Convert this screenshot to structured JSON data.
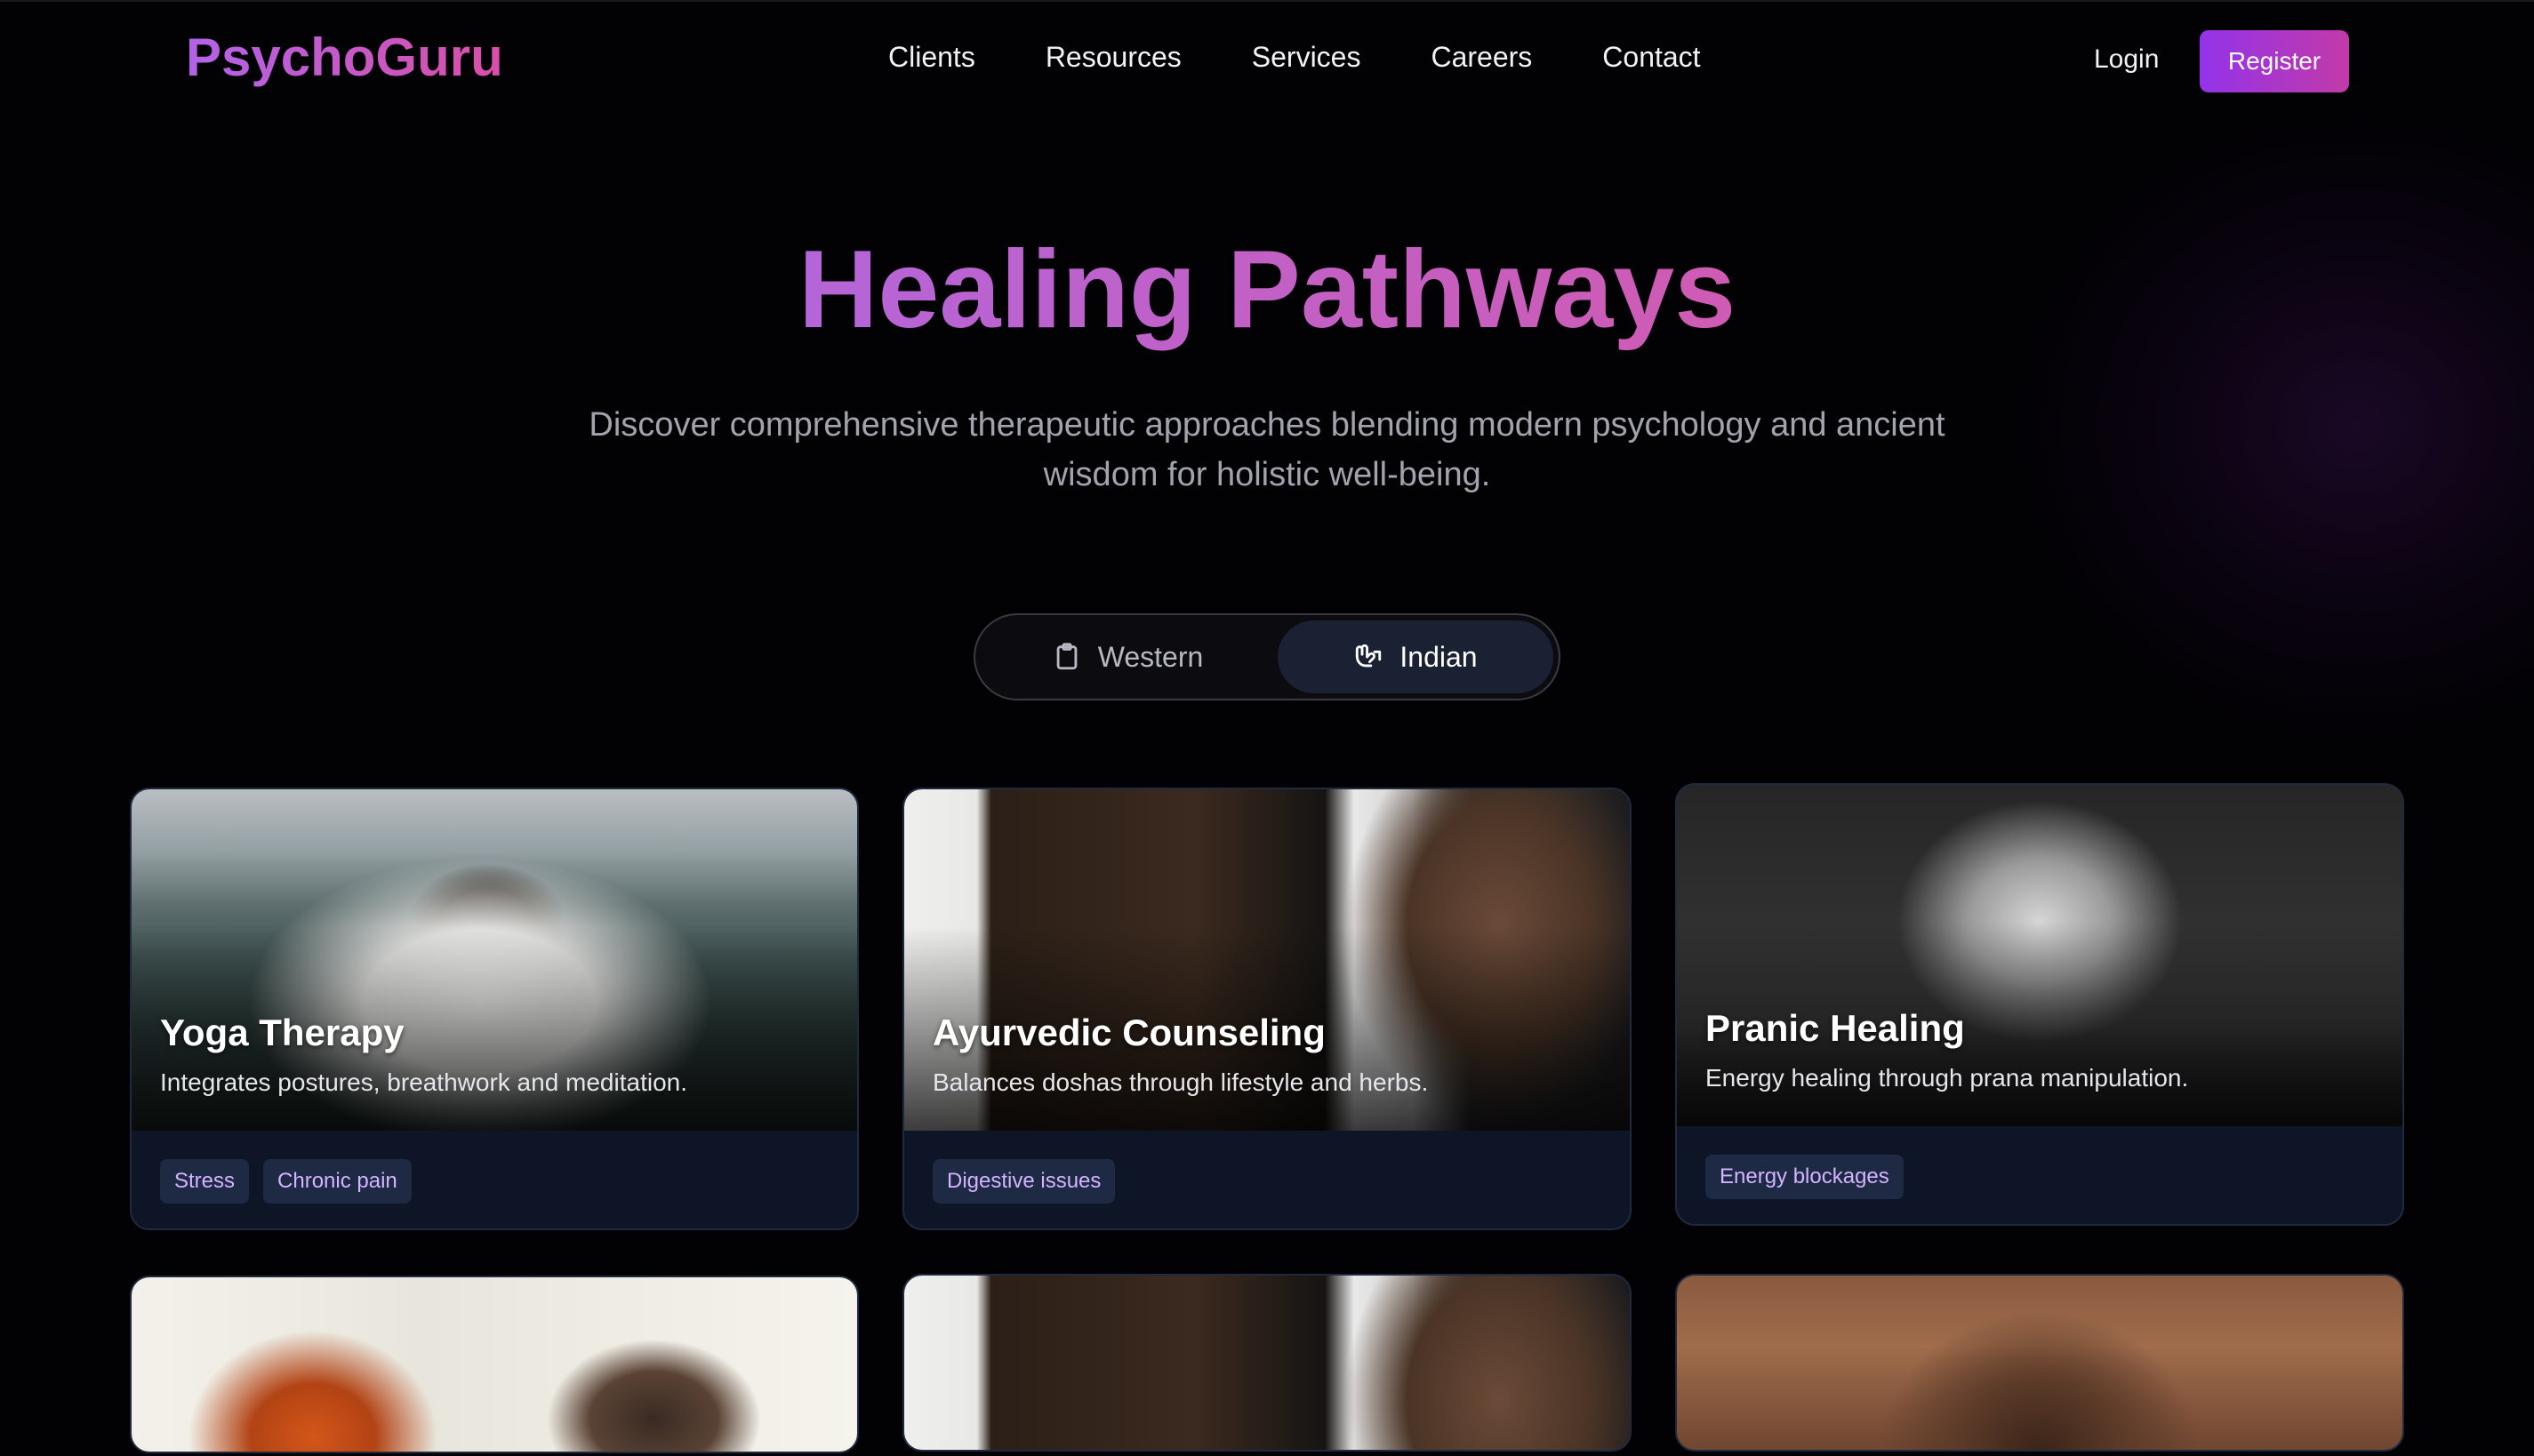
{
  "brand": {
    "name": "PsychoGuru"
  },
  "nav": {
    "links": [
      "Clients",
      "Resources",
      "Services",
      "Careers",
      "Contact"
    ],
    "login": "Login",
    "register": "Register"
  },
  "hero": {
    "title": "Healing Pathways",
    "subtitle": "Discover comprehensive therapeutic approaches blending modern psychology and ancient wisdom for holistic well-being."
  },
  "toggle": {
    "options": [
      {
        "label": "Western",
        "icon": "clipboard-icon"
      },
      {
        "label": "Indian",
        "icon": "hands-icon"
      }
    ],
    "selected": "Indian"
  },
  "cards": [
    {
      "title": "Yoga Therapy",
      "description": "Integrates postures, breathwork and meditation.",
      "tags": [
        "Stress",
        "Chronic pain"
      ]
    },
    {
      "title": "Ayurvedic Counseling",
      "description": "Balances doshas through lifestyle and herbs.",
      "tags": [
        "Digestive issues"
      ]
    },
    {
      "title": "Pranic Healing",
      "description": "Energy healing through prana manipulation.",
      "tags": [
        "Energy blockages"
      ]
    }
  ],
  "colors": {
    "accent_purple": "#9333ea",
    "accent_pink": "#c23aa8",
    "card_bg": "#0e1526",
    "tag_text": "#d4b3ff"
  }
}
